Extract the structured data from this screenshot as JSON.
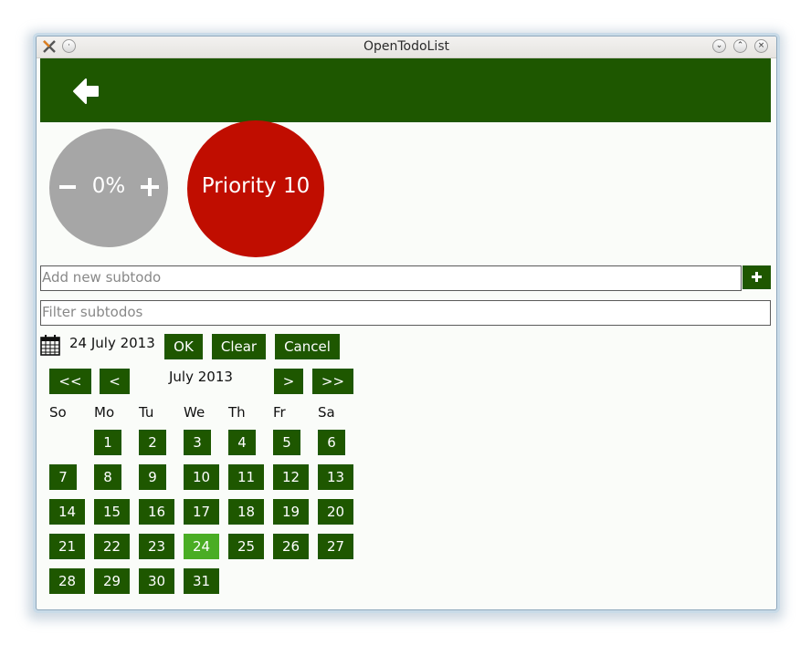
{
  "window": {
    "title": "OpenTodoList"
  },
  "progress": {
    "value_label": "0%",
    "value": 0
  },
  "priority": {
    "label": "Priority 10",
    "color": "#c00d00"
  },
  "subtodo": {
    "add_placeholder": "Add new subtodo",
    "filter_placeholder": "Filter subtodos"
  },
  "date_picker": {
    "selected_date": "24 July 2013",
    "ok_label": "OK",
    "clear_label": "Clear",
    "cancel_label": "Cancel",
    "month_label": "July 2013",
    "nav": {
      "prev_year": "<<",
      "prev_month": "<",
      "next_month": ">",
      "next_year": ">>"
    },
    "weekdays": [
      "So",
      "Mo",
      "Tu",
      "We",
      "Th",
      "Fr",
      "Sa"
    ],
    "days": [
      "1",
      "2",
      "3",
      "4",
      "5",
      "6",
      "7",
      "8",
      "9",
      "10",
      "11",
      "12",
      "13",
      "14",
      "15",
      "16",
      "17",
      "18",
      "19",
      "20",
      "21",
      "22",
      "23",
      "24",
      "25",
      "26",
      "27",
      "28",
      "29",
      "30",
      "31"
    ],
    "selected_day": "24"
  },
  "colors": {
    "accent": "#1e5700",
    "selected_day": "#4aad24",
    "progress_circle": "#a6a6a6"
  }
}
